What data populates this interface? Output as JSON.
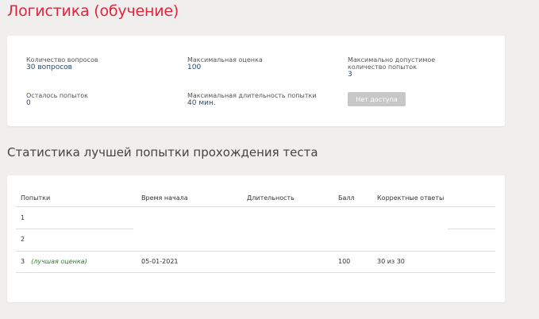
{
  "page": {
    "title": "Логистика (обучение)"
  },
  "info": {
    "question_count_label": "Количество вопросов",
    "question_count_value": "30 вопросов",
    "max_score_label": "Максимальная оценка",
    "max_score_value": "100",
    "max_attempts_label": "Максимально допустимое количество попыток",
    "max_attempts_value": "3",
    "remaining_attempts_label": "Осталось попыток",
    "remaining_attempts_value": "0",
    "max_duration_label": "Максимальная длительность попытки",
    "max_duration_value": "40 мин.",
    "no_access_button": "Нет доступа"
  },
  "stats": {
    "title": "Статистика лучшей попытки прохождения теста",
    "columns": [
      "Попытки",
      "Время начала",
      "Длительность",
      "Балл",
      "Корректные ответы"
    ],
    "rows": [
      {
        "attempt": "1",
        "note": "",
        "start": "",
        "duration": "",
        "score": "",
        "correct": ""
      },
      {
        "attempt": "2",
        "note": "",
        "start": "",
        "duration": "",
        "score": "",
        "correct": ""
      },
      {
        "attempt": "3",
        "note": "(лучшая оценка)",
        "start": "05-01-2021",
        "duration": "",
        "score": "100",
        "correct": "30 из 30"
      }
    ]
  }
}
